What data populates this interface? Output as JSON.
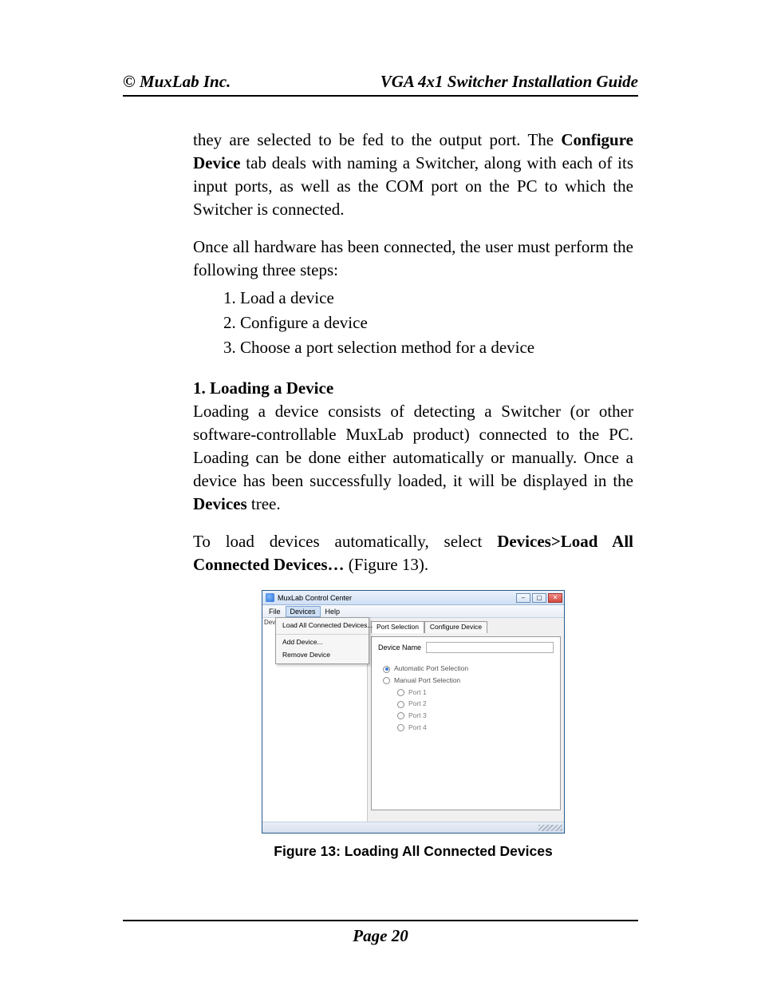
{
  "header": {
    "left": "© MuxLab Inc.",
    "right": "VGA 4x1 Switcher Installation Guide"
  },
  "body": {
    "p1a": "they are selected to be fed to the output port. The ",
    "p1b": "Configure Device",
    "p1c": " tab deals with naming a Switcher, along with each of its input ports, as well as the COM port on the PC to which the Switcher is connected.",
    "p2": "Once all hardware has been connected, the user must perform the following three steps:",
    "steps": {
      "s1": "1. Load a device",
      "s2": "2. Configure a device",
      "s3": "3. Choose a port selection method for a device"
    },
    "h1": "1. Loading a Device",
    "p3a": "Loading a device consists of detecting a Switcher (or other software-controllable MuxLab product) connected to the PC. Loading can be done either automatically or manually. Once a device has been successfully loaded, it will be displayed in the ",
    "p3b": "Devices",
    "p3c": " tree.",
    "p4a": "To load devices automatically, select ",
    "p4b": "Devices>Load All Connected Devices…",
    "p4c": " (Figure 13)."
  },
  "figure": {
    "caption": "Figure 13: Loading All Connected Devices",
    "window": {
      "title": "MuxLab Control Center",
      "menus": {
        "file": "File",
        "devices": "Devices",
        "help": "Help"
      },
      "tree_label": "Dev",
      "dropdown": {
        "item1": "Load All Connected Devices...",
        "item2": "Add Device...",
        "item3": "Remove Device"
      },
      "tabs": {
        "port_selection": "Port Selection",
        "configure_device": "Configure Device"
      },
      "panel": {
        "device_name_label": "Device Name",
        "auto_label": "Automatic Port Selection",
        "manual_label": "Manual Port Selection",
        "ports": {
          "p1": "Port 1",
          "p2": "Port 2",
          "p3": "Port 3",
          "p4": "Port 4"
        }
      }
    }
  },
  "footer": {
    "page": "Page 20"
  }
}
